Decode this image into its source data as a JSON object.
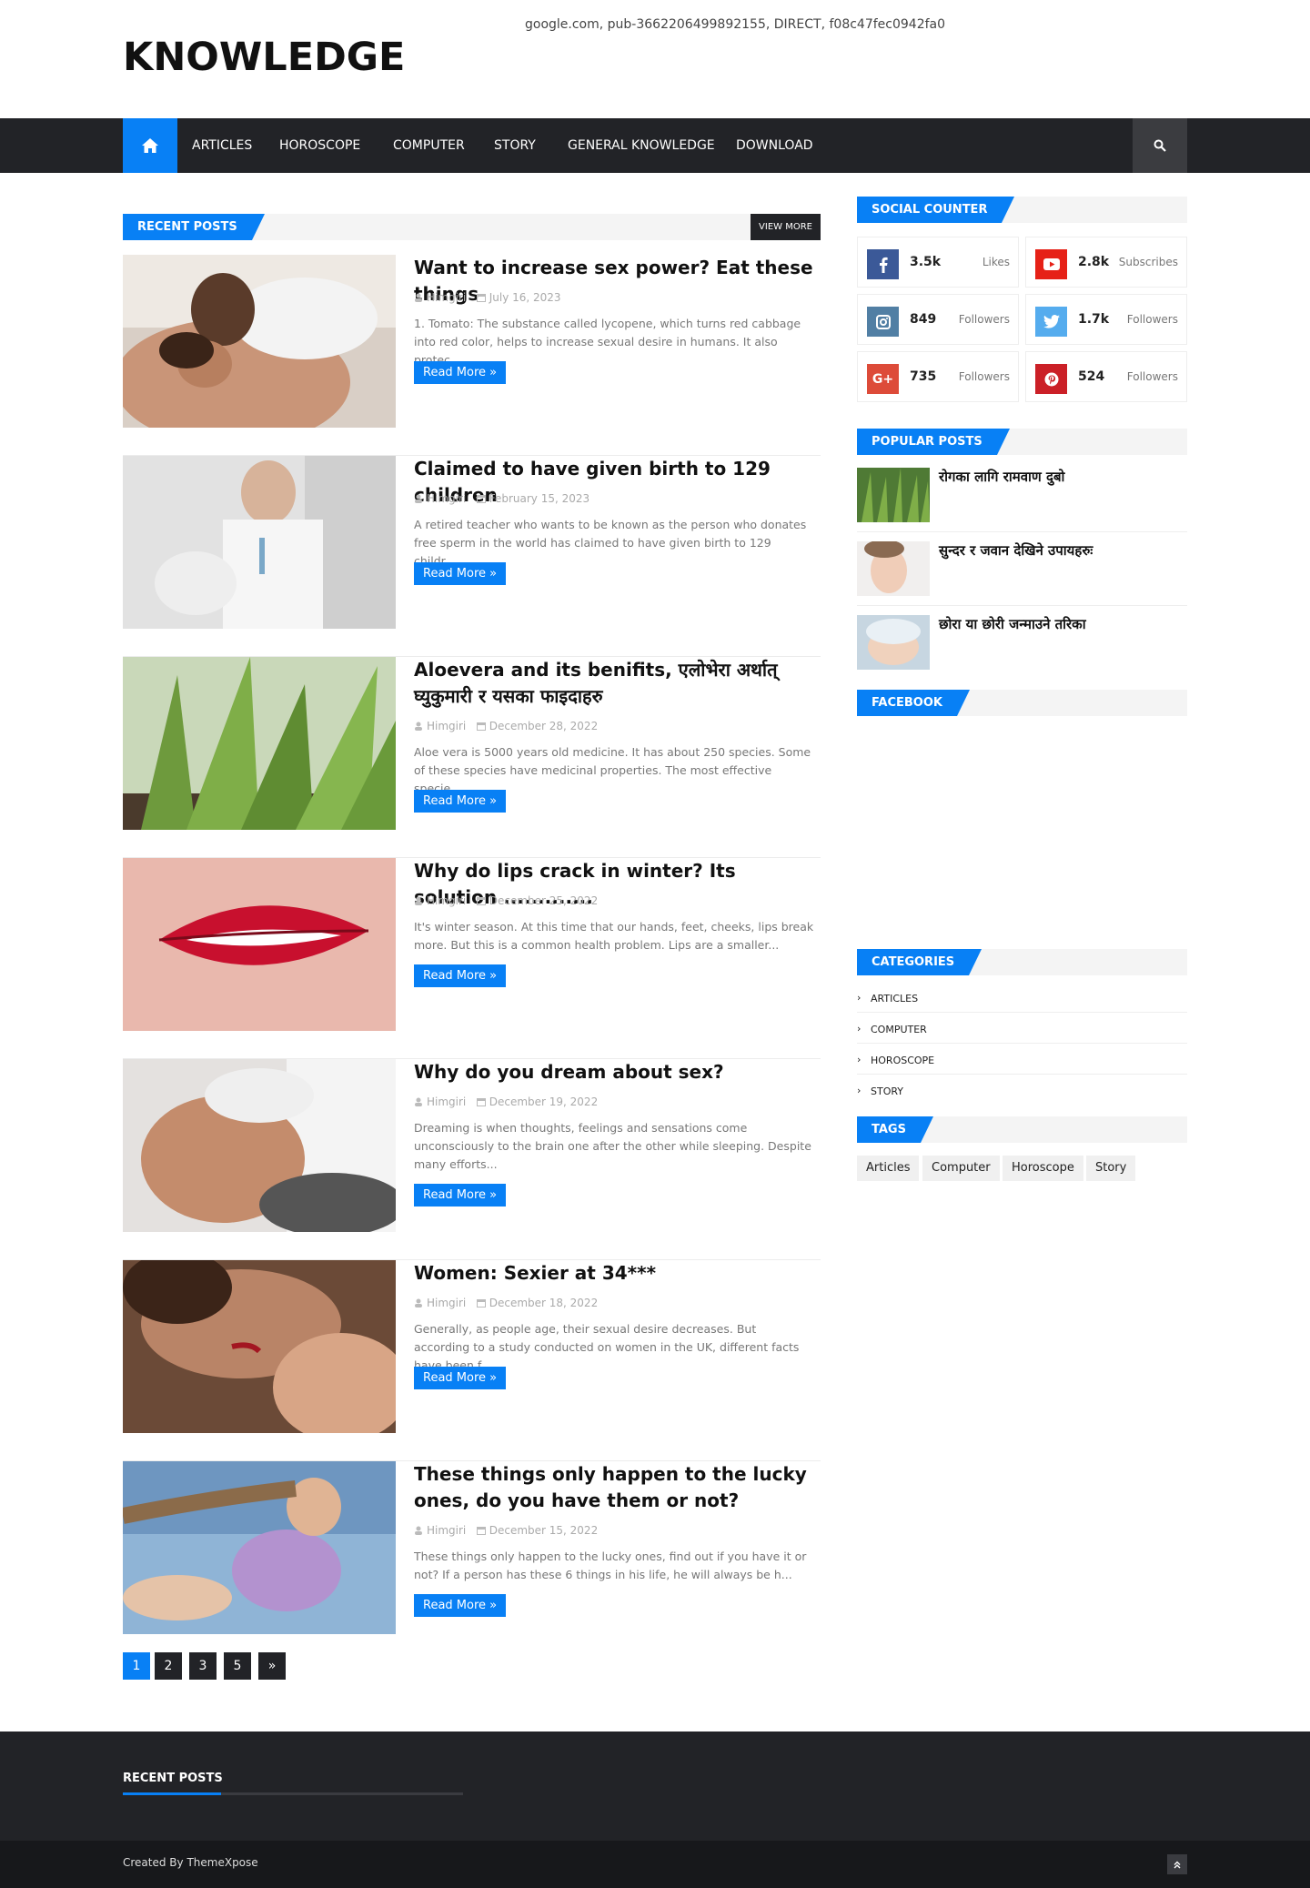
{
  "header": {
    "logo": "KNOWLEDGE",
    "ads_text": "google.com, pub-3662206499892155, DIRECT, f08c47fec0942fa0"
  },
  "nav": {
    "home_icon": "home-icon",
    "items": [
      "ARTICLES",
      "HOROSCOPE",
      "COMPUTER",
      "STORY",
      "GENERAL KNOWLEDGE",
      "DOWNLOAD"
    ],
    "search_icon": "search-icon"
  },
  "recent": {
    "heading": "RECENT POSTS",
    "view_more": "VIEW MORE",
    "read_more": "Read More »",
    "posts": [
      {
        "title": "Want to increase sex power? Eat these things",
        "author": "Himgiri",
        "date": "July 16, 2023",
        "excerpt": "1. Tomato: The substance called lycopene, which turns red cabbage into red color, helps to increase sexual desire in humans. It also protec..."
      },
      {
        "title": "Claimed to have given birth to 129 children",
        "author": "Himgiri",
        "date": "February 15, 2023",
        "excerpt": "    A retired teacher who wants to be known as the person who donates free sperm in the world has claimed to have given birth to 129 childr..."
      },
      {
        "title": "Aloevera and its benifits, एलोभेरा अर्थात् घ्युकुमारी र यसका फाइदाहरु",
        "author": "Himgiri",
        "date": "December 28, 2022",
        "excerpt": " Aloe vera is 5000 years old medicine. It has about 250 species. Some of these species have medicinal properties. The most effective specie..."
      },
      {
        "title": "Why do lips crack in winter? Its solution .............",
        "author": "Himgiri",
        "date": "December 25, 2022",
        "excerpt": " It's winter season. At this time that our hands, feet, cheeks, lips break more. But this is a common health problem. Lips are a smaller..."
      },
      {
        "title": "Why do you dream about sex?",
        "author": "Himgiri",
        "date": "December 19, 2022",
        "excerpt": " Dreaming is when thoughts, feelings and sensations come unconsciously to the brain one after the other while sleeping. Despite many efforts..."
      },
      {
        "title": "Women: Sexier at 34***",
        "author": "Himgiri",
        "date": "December 18, 2022",
        "excerpt": " Generally, as people age, their sexual desire decreases. But according to a study conducted on women in the UK, different facts have been f..."
      },
      {
        "title": "These things only happen to the lucky ones, do you have them or not?",
        "author": "Himgiri",
        "date": "December 15, 2022",
        "excerpt": " These things only happen to the lucky ones, find out if you have it or not? If a person has these 6 things in his life, he will always be h..."
      }
    ]
  },
  "pagination": [
    "1",
    "2",
    "3",
    "5",
    "»"
  ],
  "sidebar": {
    "social_heading": "SOCIAL COUNTER",
    "counters": [
      {
        "icon": "facebook-icon",
        "color": "#3b5998",
        "num": "3.5k",
        "label": "Likes"
      },
      {
        "icon": "youtube-icon",
        "color": "#e62117",
        "num": "2.8k",
        "label": "Subscribes"
      },
      {
        "icon": "instagram-icon",
        "color": "#517fa4",
        "num": "849",
        "label": "Followers"
      },
      {
        "icon": "twitter-icon",
        "color": "#55acee",
        "num": "1.7k",
        "label": "Followers"
      },
      {
        "icon": "google-plus-icon",
        "color": "#dd4b39",
        "num": "735",
        "label": "Followers"
      },
      {
        "icon": "pinterest-icon",
        "color": "#cb2027",
        "num": "524",
        "label": "Followers"
      }
    ],
    "popular_heading": "POPULAR POSTS",
    "popular": [
      {
        "title": "रोगका लागि रामवाण दुबो"
      },
      {
        "title": "सुन्दर र जवान देखिने उपायहरुः"
      },
      {
        "title": "छोरा या छोरी जन्माउने तरिका"
      }
    ],
    "facebook_heading": "FACEBOOK",
    "categories_heading": "CATEGORIES",
    "categories": [
      "ARTICLES",
      "COMPUTER",
      "HOROSCOPE",
      "STORY"
    ],
    "tags_heading": "TAGS",
    "tags": [
      "Articles",
      "Computer",
      "Horoscope",
      "Story"
    ]
  },
  "footer": {
    "heading": "RECENT POSTS",
    "credit": "Created By ThemeXpose",
    "top_icon": "double-chevron-up-icon"
  },
  "colors": {
    "accent": "#0880f5",
    "dark": "#222327"
  }
}
